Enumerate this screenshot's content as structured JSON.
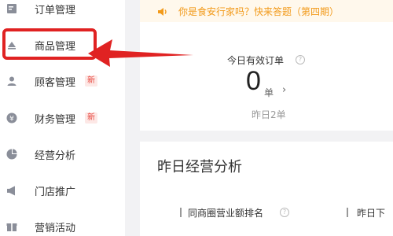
{
  "sidebar": {
    "items": [
      {
        "label": "订单管理",
        "icon": "order-list-icon"
      },
      {
        "label": "商品管理",
        "icon": "product-icon"
      },
      {
        "label": "顾客管理",
        "icon": "user-icon",
        "badge": "新"
      },
      {
        "label": "财务管理",
        "icon": "yen-icon",
        "badge": "新"
      },
      {
        "label": "经营分析",
        "icon": "pie-chart-icon"
      },
      {
        "label": "门店推广",
        "icon": "megaphone-icon"
      },
      {
        "label": "营销活动",
        "icon": "gift-icon"
      }
    ]
  },
  "notice": {
    "text": "你是食安行家吗？快来答题（第四期）",
    "icon": "speaker-icon"
  },
  "metrics": {
    "today_orders_title": "今日有效订单",
    "today_orders_value": "0",
    "today_orders_unit": "单",
    "yesterday_text": "昨日2单"
  },
  "analysis": {
    "title": "昨日经营分析",
    "rank_label": "同商圈营业额排名",
    "second_label": "昨日下"
  },
  "colors": {
    "highlight": "#e02222",
    "notice_text": "#f29a1a",
    "badge_text": "#e8453c"
  }
}
